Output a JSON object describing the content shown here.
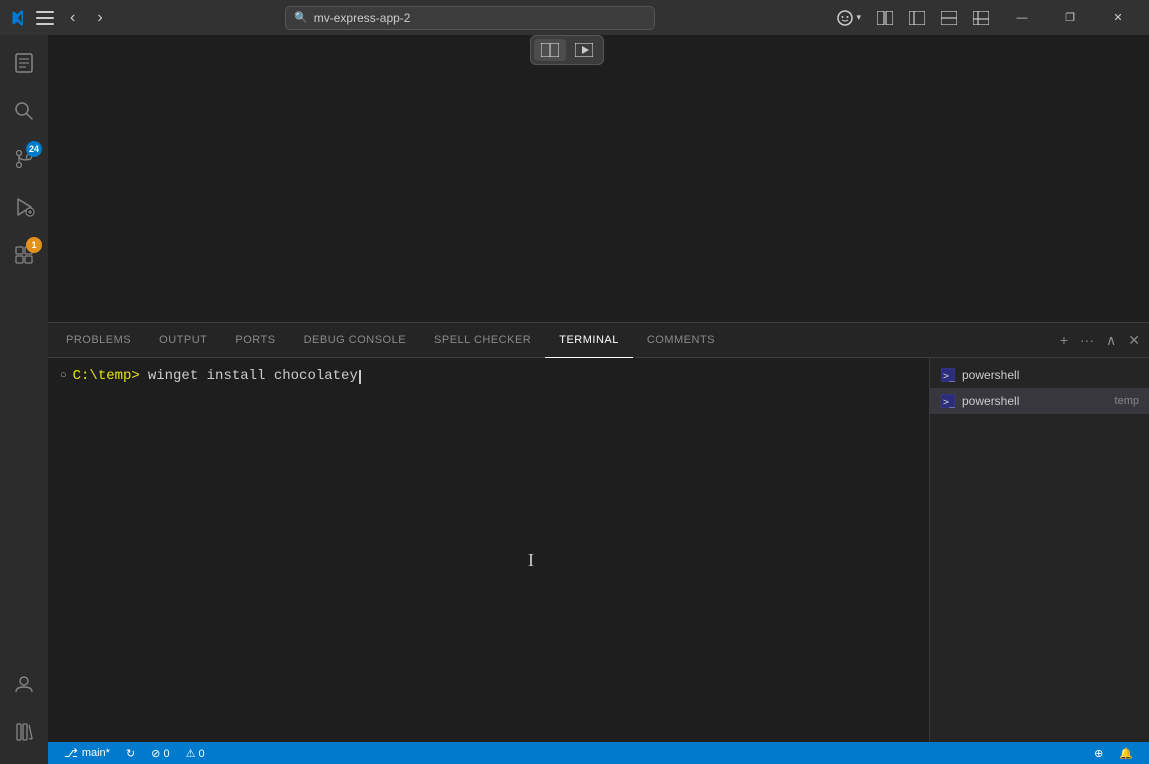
{
  "titlebar": {
    "app_title": "mv-express-app-2",
    "nav_back": "‹",
    "nav_forward": "›",
    "search_placeholder": "mv-express-app-2",
    "win_minimize": "—",
    "win_restore": "❐",
    "win_close": "✕"
  },
  "activity_bar": {
    "items": [
      {
        "id": "explorer",
        "icon": "⎘",
        "label": "Explorer",
        "active": false
      },
      {
        "id": "search",
        "icon": "🔍",
        "label": "Search",
        "active": false
      },
      {
        "id": "source-control",
        "icon": "⑃",
        "label": "Source Control",
        "active": false,
        "badge": "24"
      },
      {
        "id": "run",
        "icon": "▶",
        "label": "Run and Debug",
        "active": false
      },
      {
        "id": "extensions",
        "icon": "⊞",
        "label": "Extensions",
        "active": false,
        "badge": "1"
      }
    ],
    "bottom_items": [
      {
        "id": "account",
        "icon": "👤",
        "label": "Account"
      },
      {
        "id": "library",
        "icon": "📚",
        "label": "Library"
      }
    ]
  },
  "panel": {
    "tabs": [
      {
        "id": "problems",
        "label": "PROBLEMS",
        "active": false
      },
      {
        "id": "output",
        "label": "OUTPUT",
        "active": false
      },
      {
        "id": "ports",
        "label": "PORTS",
        "active": false
      },
      {
        "id": "debug-console",
        "label": "DEBUG CONSOLE",
        "active": false
      },
      {
        "id": "spell-checker",
        "label": "SPELL CHECKER",
        "active": false
      },
      {
        "id": "terminal",
        "label": "TERMINAL",
        "active": true
      },
      {
        "id": "comments",
        "label": "COMMENTS",
        "active": false
      }
    ],
    "actions": {
      "add_label": "+",
      "more_label": "···",
      "maximize_label": "∧",
      "close_label": "✕"
    }
  },
  "terminal": {
    "prompt": "C:\\temp>",
    "command": "winget install chocolatey",
    "cursor": "|"
  },
  "terminal_sessions": [
    {
      "id": "ps1",
      "label": "powershell",
      "sublabel": "",
      "selected": false
    },
    {
      "id": "ps2",
      "label": "powershell",
      "sublabel": "temp",
      "selected": true
    }
  ],
  "status_bar": {
    "branch": "main*",
    "sync": "↻",
    "errors": "⊘ 0",
    "warnings": "⚠ 0",
    "zoom_icon": "⊕",
    "bell_icon": "🔔",
    "line_info": ""
  },
  "floating_toolbar": {
    "btn1": "⊡",
    "btn2": "▶"
  }
}
